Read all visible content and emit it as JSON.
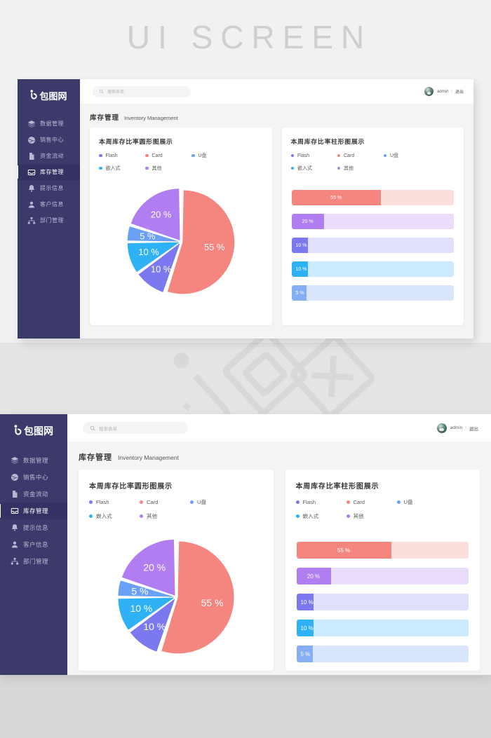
{
  "banner": {
    "title": "UI SCREEN"
  },
  "watermark": {
    "text": "包图网"
  },
  "brand": {
    "logo_mark": "b",
    "logo_text": "包图网",
    "sidebar_bg": "#3b3a6b",
    "active_bg": "#343263"
  },
  "sidebar": {
    "items": [
      {
        "label": "数据管理",
        "icon": "layers-icon",
        "active": false
      },
      {
        "label": "销售中心",
        "icon": "sales-globe-icon",
        "active": false
      },
      {
        "label": "资金流动",
        "icon": "document-icon",
        "active": false
      },
      {
        "label": "库存管理",
        "icon": "inbox-icon",
        "active": true
      },
      {
        "label": "提示信息",
        "icon": "bell-icon",
        "active": false
      },
      {
        "label": "客户信息",
        "icon": "user-icon",
        "active": false
      },
      {
        "label": "部门管理",
        "icon": "sitemap-icon",
        "active": false
      }
    ]
  },
  "topbar": {
    "search": {
      "placeholder": "搜索表单",
      "value": "",
      "icon": "search-icon"
    },
    "user": {
      "name": "admin",
      "separator": "|",
      "logout_label": "退出",
      "avatar_icon": "avatar"
    }
  },
  "page": {
    "title_cn": "库存管理",
    "title_en": "Inventory Management"
  },
  "cards": [
    {
      "title": "本周库存比率圆形图展示",
      "legend": [
        {
          "label": "Flash",
          "color": "#7b78f0"
        },
        {
          "label": "Card",
          "color": "#f5867f"
        },
        {
          "label": "U盘",
          "color": "#6aa0f5"
        },
        {
          "label": "嵌入式",
          "color": "#2fb1f5"
        },
        {
          "label": "其他",
          "color": "#b07ef0"
        }
      ]
    },
    {
      "title": "本周库存比率柱形图展示",
      "legend": [
        {
          "label": "Flash",
          "color": "#7b78f0"
        },
        {
          "label": "Card",
          "color": "#f5867f"
        },
        {
          "label": "U盘",
          "color": "#6aa0f5"
        },
        {
          "label": "嵌入式",
          "color": "#2fb1f5"
        },
        {
          "label": "其他",
          "color": "#b07ef0"
        }
      ]
    }
  ],
  "chart_data": [
    {
      "type": "pie",
      "title": "本周库存比率圆形图展示",
      "categories": [
        "Card",
        "Flash",
        "嵌入式",
        "U盘",
        "其他"
      ],
      "values": [
        55,
        10,
        10,
        5,
        20
      ],
      "labels": [
        "55 %",
        "10 %",
        "10 %",
        "5 %",
        "20 %"
      ],
      "colors": [
        "#f5867f",
        "#7b78f0",
        "#2fb1f5",
        "#6aa0f5",
        "#b07ef0"
      ],
      "unit": "%",
      "legend_position": "top-left",
      "exploded": true,
      "start_angle_deg": 0
    },
    {
      "type": "bar",
      "orientation": "horizontal",
      "title": "本周库存比率柱形图展示",
      "categories": [
        "Card",
        "其他",
        "Flash",
        "嵌入式",
        "U盘"
      ],
      "values": [
        55,
        20,
        10,
        10,
        5
      ],
      "labels": [
        "55 %",
        "20 %",
        "10 %",
        "10 %",
        "5 %"
      ],
      "colors": [
        "#f5867f",
        "#b07ef0",
        "#7b78f0",
        "#2fb1f5",
        "#86aef5"
      ],
      "track_colors": [
        "#fbdfdc",
        "#eadcfb",
        "#e1e0fb",
        "#cbeafd",
        "#d9e5fb"
      ],
      "xlim": [
        0,
        100
      ],
      "unit": "%",
      "grid": false,
      "legend_position": "top-left"
    }
  ]
}
